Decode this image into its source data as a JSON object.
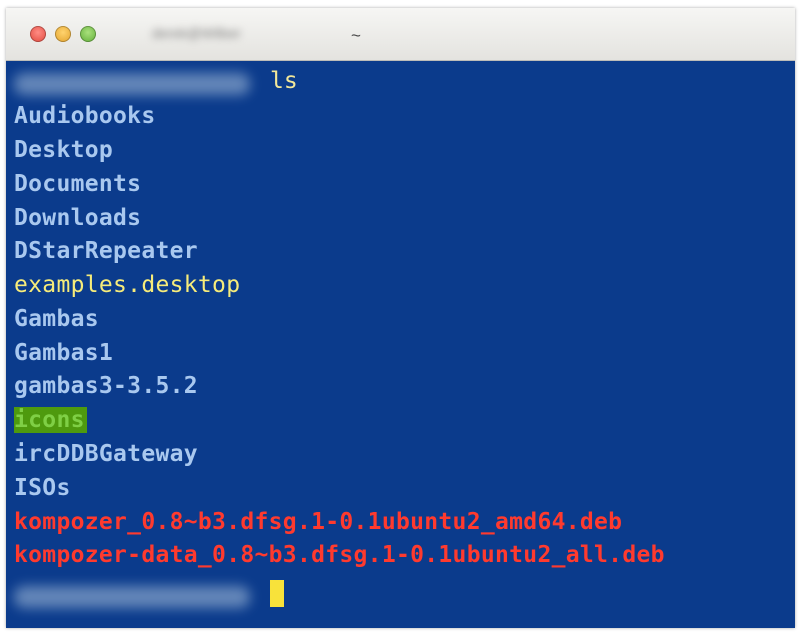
{
  "window": {
    "title_user": "derek@Wilber",
    "title_path": "~"
  },
  "terminal": {
    "command": "ls",
    "entries": [
      {
        "name": "Audiobooks",
        "kind": "directory"
      },
      {
        "name": "Desktop",
        "kind": "directory"
      },
      {
        "name": "Documents",
        "kind": "directory"
      },
      {
        "name": "Downloads",
        "kind": "directory"
      },
      {
        "name": "DStarRepeater",
        "kind": "directory"
      },
      {
        "name": "examples.desktop",
        "kind": "file"
      },
      {
        "name": "Gambas",
        "kind": "directory"
      },
      {
        "name": "Gambas1",
        "kind": "directory"
      },
      {
        "name": "gambas3-3.5.2",
        "kind": "directory"
      },
      {
        "name": "icons",
        "kind": "directory-highlighted"
      },
      {
        "name": "ircDDBGateway",
        "kind": "directory"
      },
      {
        "name": "ISOs",
        "kind": "directory"
      },
      {
        "name": "kompozer_0.8~b3.dfsg.1-0.1ubuntu2_amd64.deb",
        "kind": "archive"
      },
      {
        "name": "kompozer-data_0.8~b3.dfsg.1-0.1ubuntu2_all.deb",
        "kind": "archive"
      }
    ]
  },
  "colors": {
    "background": "#0b3b8c",
    "directory": "#a9c8ef",
    "file": "#f7ec7a",
    "archive": "#ff3a2e",
    "highlight_bg": "#4e9a0e",
    "cursor": "#f8e23a"
  }
}
